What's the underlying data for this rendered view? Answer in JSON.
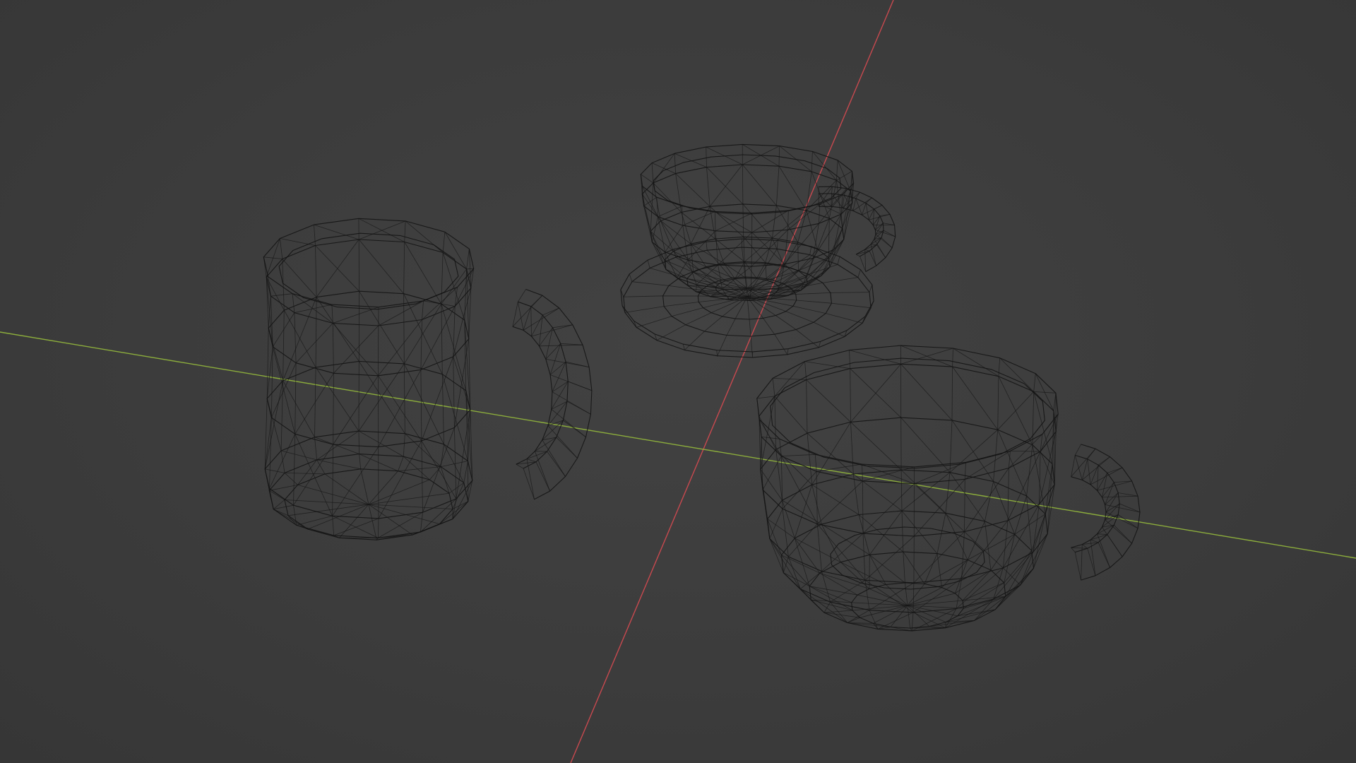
{
  "viewport": {
    "background": "#3d3d3d",
    "mode": "wireframe"
  },
  "axes": {
    "x_axis_color": "#c8494f",
    "y_axis_color": "#8cad3c"
  },
  "objects": [
    {
      "name": "mug",
      "type": "wireframe-mesh"
    },
    {
      "name": "teacup-with-saucer",
      "type": "wireframe-mesh"
    },
    {
      "name": "wide-cup",
      "type": "wireframe-mesh"
    }
  ],
  "colors": {
    "wireframe": "#121212"
  }
}
